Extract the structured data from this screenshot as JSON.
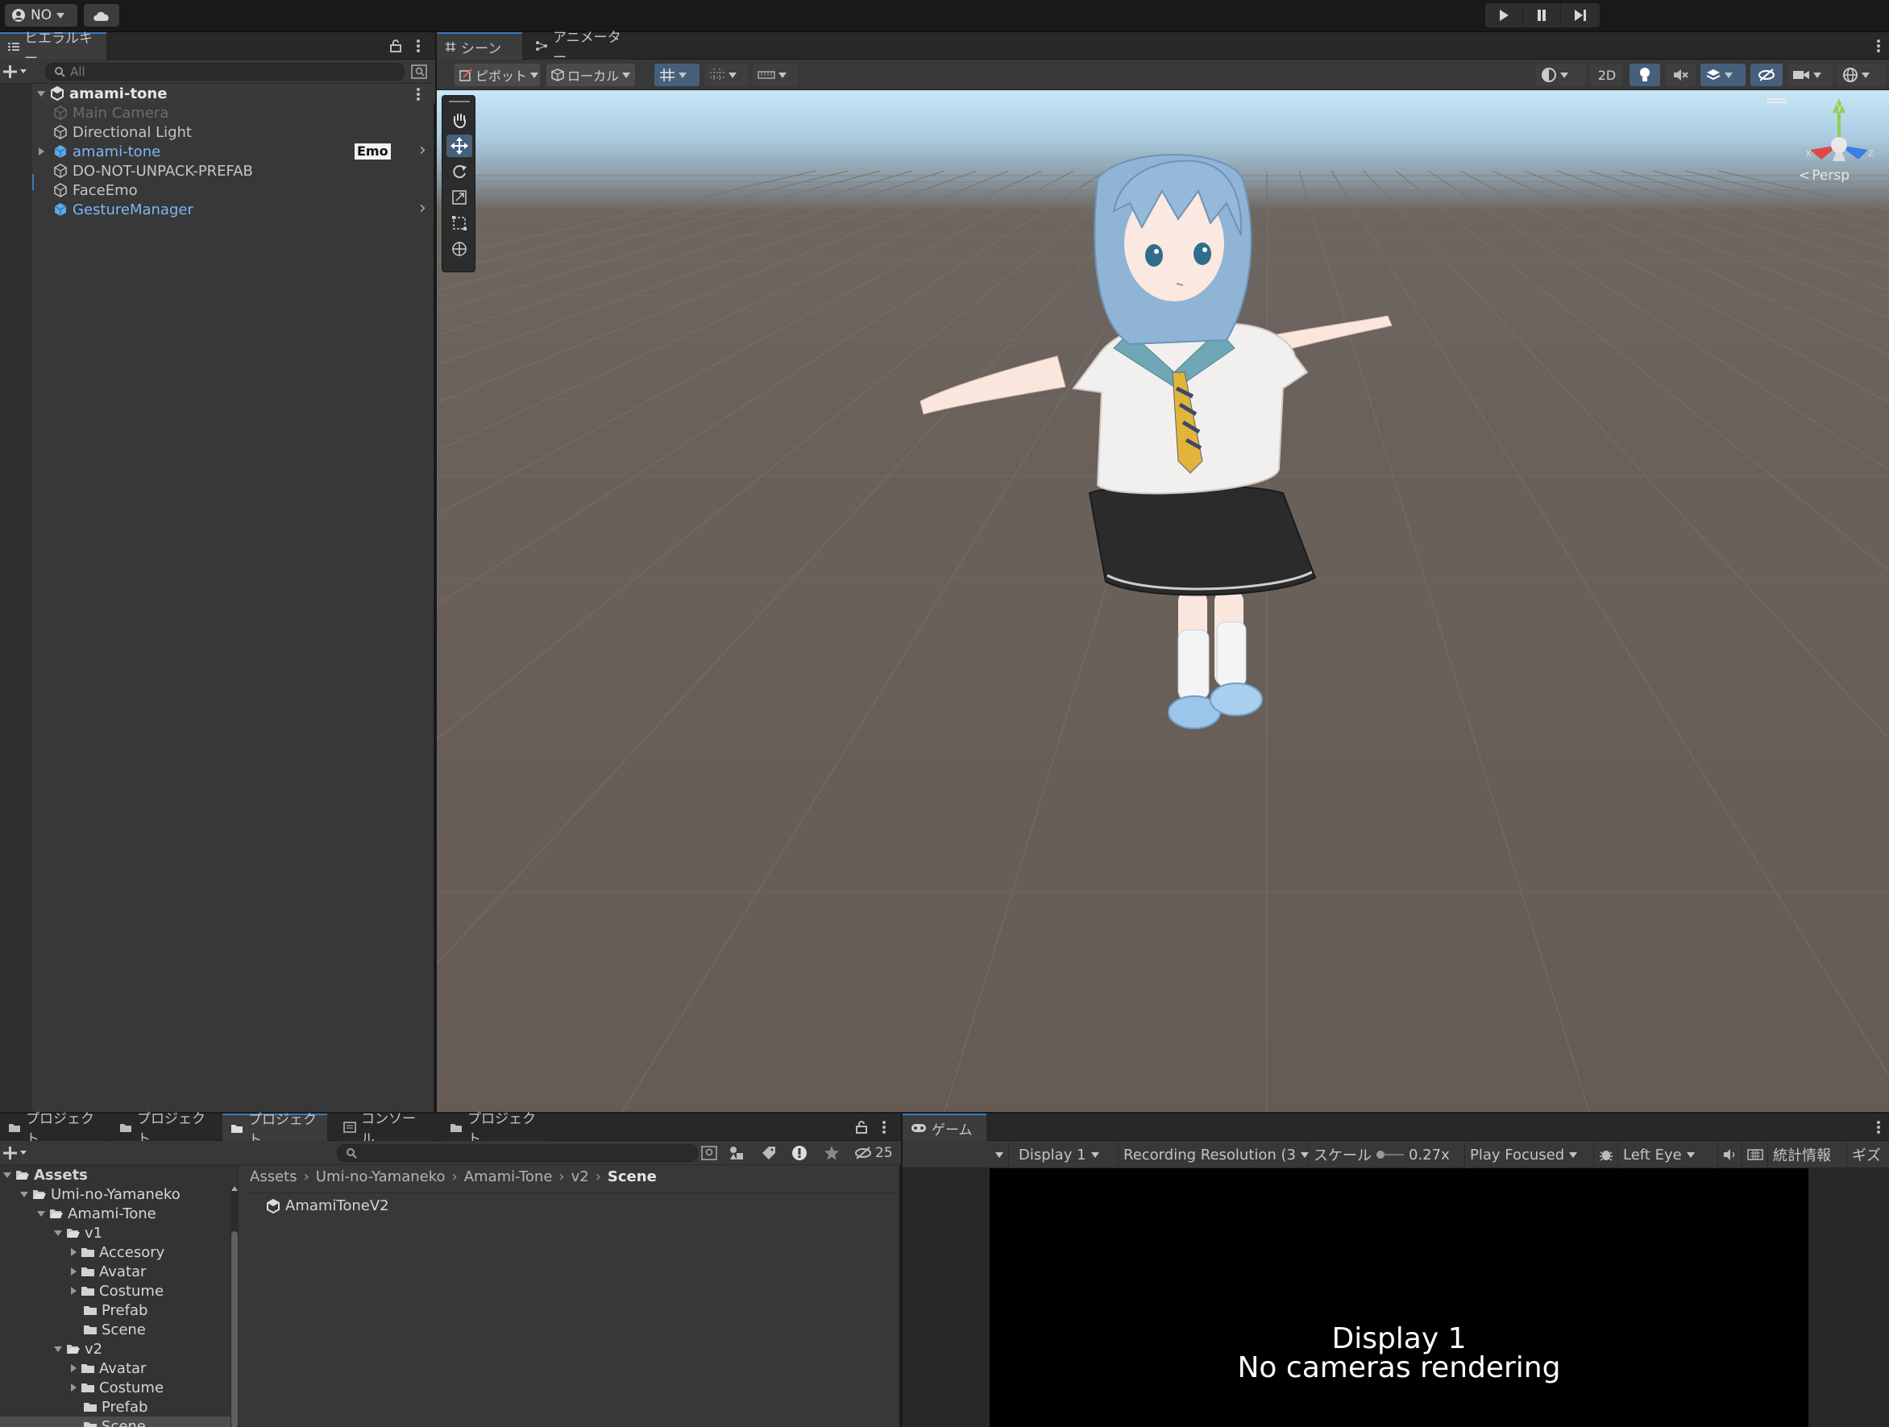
{
  "topbar": {
    "account_label": "NO",
    "play_icons": [
      "play-icon",
      "pause-icon",
      "step-icon"
    ]
  },
  "hierarchy": {
    "tab_label": "ヒエラルキー",
    "search_placeholder": "All",
    "root": "amami-tone",
    "items": [
      {
        "label": "Main Camera",
        "color": "#6b6b6b"
      },
      {
        "label": "Directional Light",
        "color": "#c4c4c4"
      },
      {
        "label": "amami-tone",
        "color": "#7fb5f5",
        "badge": "Emo"
      },
      {
        "label": "DO-NOT-UNPACK-PREFAB",
        "color": "#c4c4c4"
      },
      {
        "label": "FaceEmo",
        "color": "#c4c4c4"
      },
      {
        "label": "GestureManager",
        "color": "#7fb5f5"
      }
    ]
  },
  "scene": {
    "tabs": [
      "シーン",
      "アニメーター"
    ],
    "pivot_label": "ピボット",
    "local_label": "ローカル",
    "mode_2d": "2D",
    "gizmo_persp": "Persp",
    "gizmo_axes": {
      "x": "x",
      "y": "y",
      "z": "z"
    }
  },
  "project": {
    "tabs": [
      "プロジェクト",
      "プロジェクト",
      "プロジェクト",
      "コンソール",
      "プロジェクト"
    ],
    "hidden_count": "25",
    "breadcrumb": [
      "Assets",
      "Umi-no-Yamaneko",
      "Amami-Tone",
      "v2",
      "Scene"
    ],
    "tree": [
      {
        "label": "Assets",
        "depth": 0,
        "open": true,
        "bold": true
      },
      {
        "label": "Umi-no-Yamaneko",
        "depth": 1,
        "open": true
      },
      {
        "label": "Amami-Tone",
        "depth": 2,
        "open": true
      },
      {
        "label": "v1",
        "depth": 3,
        "open": true
      },
      {
        "label": "Accesory",
        "depth": 4,
        "open": false
      },
      {
        "label": "Avatar",
        "depth": 4,
        "open": false
      },
      {
        "label": "Costume",
        "depth": 4,
        "open": false
      },
      {
        "label": "Prefab",
        "depth": 4,
        "leaf": true
      },
      {
        "label": "Scene",
        "depth": 4,
        "leaf": true
      },
      {
        "label": "v2",
        "depth": 3,
        "open": true
      },
      {
        "label": "Avatar",
        "depth": 4,
        "open": false
      },
      {
        "label": "Costume",
        "depth": 4,
        "open": false
      },
      {
        "label": "Prefab",
        "depth": 4,
        "leaf": true
      },
      {
        "label": "Scene",
        "depth": 4,
        "leaf": true,
        "selected": true
      }
    ],
    "files": [
      "AmamiToneV2"
    ]
  },
  "game": {
    "tab_label": "ゲーム",
    "display": "Display 1",
    "resolution": "Recording Resolution (3",
    "scale_label": "スケール",
    "scale_value": "0.27x",
    "play_mode": "Play Focused",
    "eye": "Left Eye",
    "stats": "統計情報",
    "gizmos": "ギズ",
    "message_line1": "Display 1",
    "message_line2": "No cameras rendering"
  }
}
